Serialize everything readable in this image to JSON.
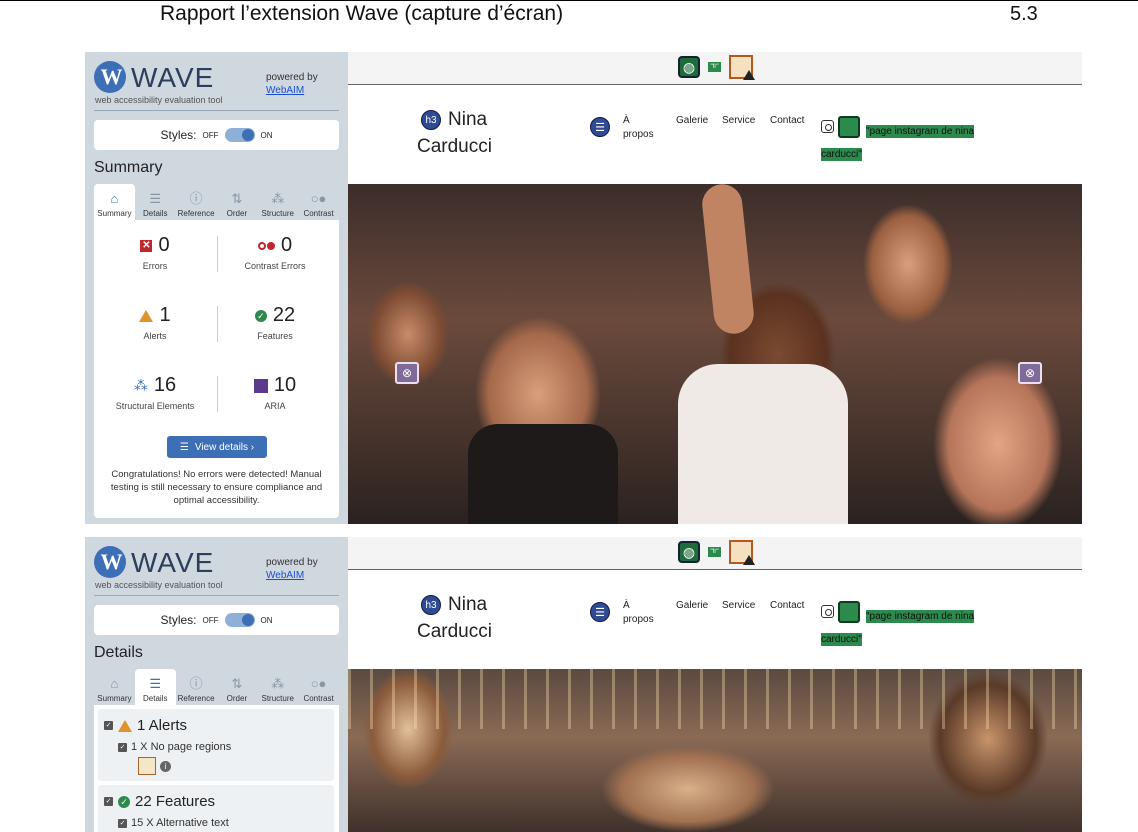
{
  "doc": {
    "title": "Rapport l’extension Wave (capture d’écran)",
    "page_number": "5.3"
  },
  "wave": {
    "name": "WAVE",
    "logo_letter": "W",
    "tagline": "web accessibility evaluation tool",
    "powered_by": "powered by",
    "webaim": "WebAIM",
    "styles_label": "Styles:",
    "styles_off": "OFF",
    "styles_on": "ON",
    "tabs": [
      {
        "label": "Summary",
        "icon": "home-icon",
        "glyph": "⌂"
      },
      {
        "label": "Details",
        "icon": "list-icon",
        "glyph": "☰"
      },
      {
        "label": "Reference",
        "icon": "info-icon",
        "glyph": "ⓘ"
      },
      {
        "label": "Order",
        "icon": "order-icon",
        "glyph": "⇅"
      },
      {
        "label": "Structure",
        "icon": "structure-icon",
        "glyph": "⁂"
      },
      {
        "label": "Contrast",
        "icon": "contrast-icon",
        "glyph": "○●"
      }
    ]
  },
  "summary": {
    "panel_title": "Summary",
    "errors": {
      "value": "0",
      "label": "Errors"
    },
    "contrast_errors": {
      "value": "0",
      "label": "Contrast Errors"
    },
    "alerts": {
      "value": "1",
      "label": "Alerts"
    },
    "features": {
      "value": "22",
      "label": "Features"
    },
    "structural": {
      "value": "16",
      "label": "Structural Elements"
    },
    "aria": {
      "value": "10",
      "label": "ARIA"
    },
    "view_details": "View details ›",
    "congrats": "Congratulations! No errors were detected! Manual testing is still necessary to ensure compliance and optimal accessibility."
  },
  "details": {
    "panel_title": "Details",
    "alerts_heading": "1 Alerts",
    "alerts_item": "1 X No page regions",
    "features_heading": "22 Features",
    "features_item": "15 X Alternative text"
  },
  "site": {
    "brand_tag": "h3",
    "brand_line1": "Nina",
    "brand_line2": "Carducci",
    "nav": [
      "À propos",
      "Galerie",
      "Service",
      "Contact"
    ],
    "alt_line1": "\"page instagram de nina",
    "alt_line2": "carducci\"",
    "lang_badge": "\"fr\""
  },
  "colors": {
    "wave_blue": "#3d6fb6",
    "feature_green": "#2c8a4c",
    "error_red": "#c0262d",
    "alert_orange": "#e0922c",
    "aria_purple": "#5a3a8a"
  }
}
